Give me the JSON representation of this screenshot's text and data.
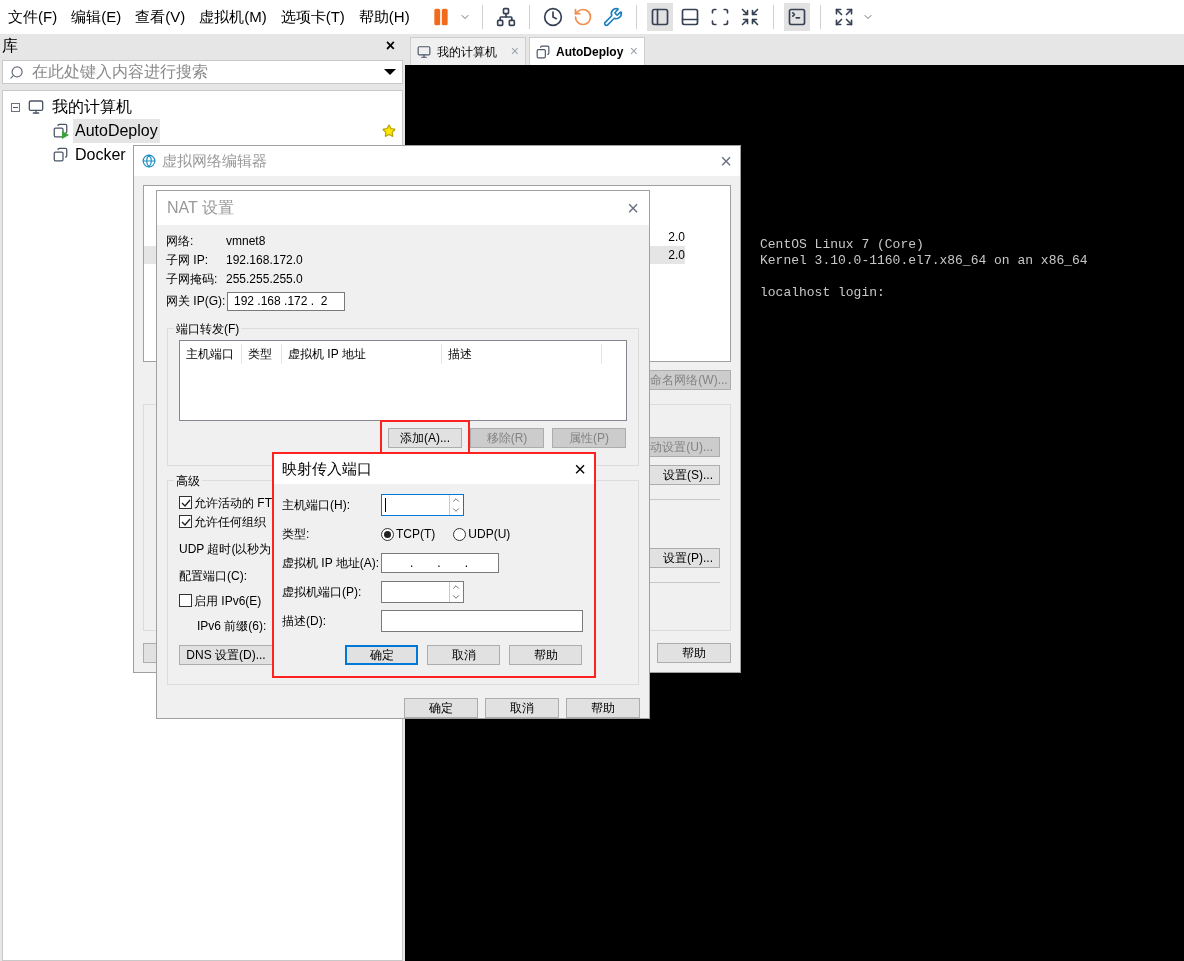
{
  "menu_bar": [
    "文件(F)",
    "编辑(E)",
    "查看(V)",
    "虚拟机(M)",
    "选项卡(T)",
    "帮助(H)"
  ],
  "toolbar": [
    {
      "kind": "pause",
      "selected": false
    },
    {
      "kind": "caret",
      "selected": false
    },
    {
      "kind": "sep"
    },
    {
      "kind": "send",
      "selected": false
    },
    {
      "kind": "sep"
    },
    {
      "kind": "snapshot",
      "selected": false
    },
    {
      "kind": "revert",
      "selected": false
    },
    {
      "kind": "manage",
      "selected": false
    },
    {
      "kind": "sep"
    },
    {
      "kind": "library",
      "selected": true
    },
    {
      "kind": "thumbs",
      "selected": false
    },
    {
      "kind": "fullscreen",
      "selected": false
    },
    {
      "kind": "unity",
      "selected": false
    },
    {
      "kind": "sep"
    },
    {
      "kind": "console",
      "selected": true
    },
    {
      "kind": "sep"
    },
    {
      "kind": "stretch",
      "selected": false
    },
    {
      "kind": "caret",
      "selected": false
    }
  ],
  "library": {
    "title": "库",
    "close": "×",
    "search": {
      "placeholder": "在此处键入内容进行搜索"
    },
    "tree": [
      {
        "label": "我的计算机",
        "expanded": true,
        "children": [
          {
            "label": "AutoDeploy",
            "selected": true,
            "running": true,
            "favorite": true
          },
          {
            "label": "Docker",
            "selected": false,
            "running": false
          }
        ]
      }
    ]
  },
  "tabs": [
    {
      "label": "我的计算机",
      "selected": false,
      "close": "×"
    },
    {
      "label": "AutoDeploy",
      "selected": true,
      "close": "×"
    }
  ],
  "console": [
    [
      "CentOS Linux 7 (Core)",
      "Kernel 3.10.0-1160.el7.x86_64 on an x86_64"
    ],
    [
      "localhost login:"
    ]
  ],
  "network_editor": {
    "title": "虚拟网络编辑器",
    "close": "×",
    "rows": [
      {
        "subnet": "2.0",
        "selected": false
      },
      {
        "subnet": "2.0",
        "selected": true
      }
    ],
    "rename_button": {
      "label": "命名网络(W)...",
      "disabled": true
    },
    "side_buttons": [
      {
        "label": "动设置(U)...",
        "disabled": true
      },
      {
        "label": "设置(S)...",
        "disabled": false
      },
      {
        "label": "设置(P)...",
        "disabled": false
      }
    ],
    "bottom_right": "帮助"
  },
  "nat_settings": {
    "title": "NAT 设置",
    "close": "×",
    "info": [
      {
        "label": "网络:",
        "value": "vmnet8"
      },
      {
        "label": "子网 IP:",
        "value": "192.168.172.0"
      },
      {
        "label": "子网掩码:",
        "value": "255.255.255.0"
      }
    ],
    "gateway": {
      "label": "网关 IP(G):",
      "value": "192 .168 .172 .  2"
    },
    "port_forwarding": {
      "label": "端口转发(F)",
      "columns": [
        "主机端口",
        "类型",
        "虚拟机 IP 地址",
        "描述"
      ],
      "buttons": [
        {
          "label": "添加(A)...",
          "disabled": false,
          "highlighted": true
        },
        {
          "label": "移除(R)",
          "disabled": true,
          "highlighted": false
        },
        {
          "label": "属性(P)",
          "disabled": true,
          "highlighted": false
        }
      ]
    },
    "advanced": {
      "label": "高级",
      "items": [
        {
          "kind": "checkbox",
          "label": "允许活动的 FT",
          "checked": true
        },
        {
          "kind": "checkbox",
          "label": "允许任何组织",
          "checked": true
        },
        {
          "kind": "text",
          "label": "UDP 超时(以秒为"
        },
        {
          "kind": "text",
          "label": "配置端口(C):"
        },
        {
          "kind": "checkbox",
          "label": "启用 IPv6(E)",
          "checked": false
        },
        {
          "kind": "indent",
          "label": "IPv6 前缀(6):"
        },
        {
          "kind": "button",
          "label": "DNS 设置(D)..."
        }
      ]
    },
    "buttons": [
      "确定",
      "取消",
      "帮助"
    ]
  },
  "port_mapping": {
    "title": "映射传入端口",
    "close": "×",
    "highlighted": true,
    "host_port": {
      "label": "主机端口(H):",
      "focused": true
    },
    "type": {
      "label": "类型:",
      "options": [
        {
          "label": "TCP(T)",
          "selected": true
        },
        {
          "label": "UDP(U)",
          "selected": false
        }
      ]
    },
    "vm_ip": {
      "label": "虚拟机 IP 地址(A):",
      "separators": [
        ".",
        ".",
        "."
      ]
    },
    "vm_port": {
      "label": "虚拟机端口(P):",
      "focused": false
    },
    "description": {
      "label": "描述(D):"
    },
    "buttons": [
      {
        "label": "确定",
        "default": true
      },
      {
        "label": "取消",
        "default": false
      },
      {
        "label": "帮助",
        "default": false
      }
    ]
  }
}
